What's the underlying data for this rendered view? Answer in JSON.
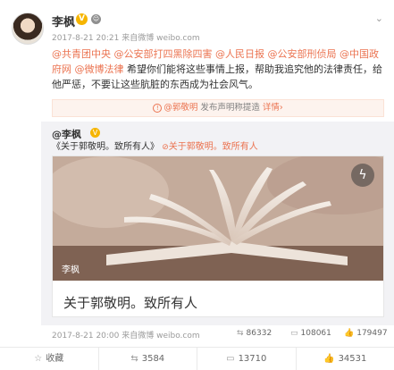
{
  "post": {
    "author": "李枫",
    "meta": "2017-8-21 20:21 来自微博 weibo.com",
    "content_segments": [
      {
        "text": "@共青团中央",
        "mention": true
      },
      {
        "text": " ",
        "mention": false
      },
      {
        "text": "@公安部打四黑除四害",
        "mention": true
      },
      {
        "text": " ",
        "mention": false
      },
      {
        "text": "@人民日报",
        "mention": true
      },
      {
        "text": " ",
        "mention": false
      },
      {
        "text": "@公安部刑侦局",
        "mention": true
      },
      {
        "text": " ",
        "mention": false
      },
      {
        "text": "@中国政府网",
        "mention": true
      },
      {
        "text": " ",
        "mention": false
      },
      {
        "text": "@微博法律",
        "mention": true
      },
      {
        "text": " 希望你们能将这些事情上报，帮助我追究他的法律责任，给他严惩，不要让这些肮脏的东西成为社会风气。",
        "mention": false
      }
    ]
  },
  "notice": {
    "mention": "@郭敬明",
    "text": " 发布声明称提造 ",
    "link": "详情›"
  },
  "repost": {
    "author": "@李枫",
    "text_prefix": "《关于郭敬明。致所有人》",
    "link_text": "关于郭敬明。致所有人",
    "card": {
      "image_label": "李枫",
      "title": "关于郭敬明。致所有人"
    },
    "meta": "2017-8-21 20:00 来自微博 weibo.com",
    "reposts": "86332",
    "comments": "108061",
    "likes": "179497"
  },
  "footer": {
    "favorite": "收藏",
    "repost": "3584",
    "comment": "13710",
    "like": "34531"
  },
  "icons": {
    "verified": "verified-badge-icon",
    "chevron": "chevron-down-icon",
    "flash": "lightning-icon",
    "repost": "repost-icon",
    "comment": "comment-icon",
    "like": "thumbs-up-icon",
    "favorite": "star-icon"
  },
  "colors": {
    "accent": "#eb7350",
    "verified": "#f6b500"
  }
}
